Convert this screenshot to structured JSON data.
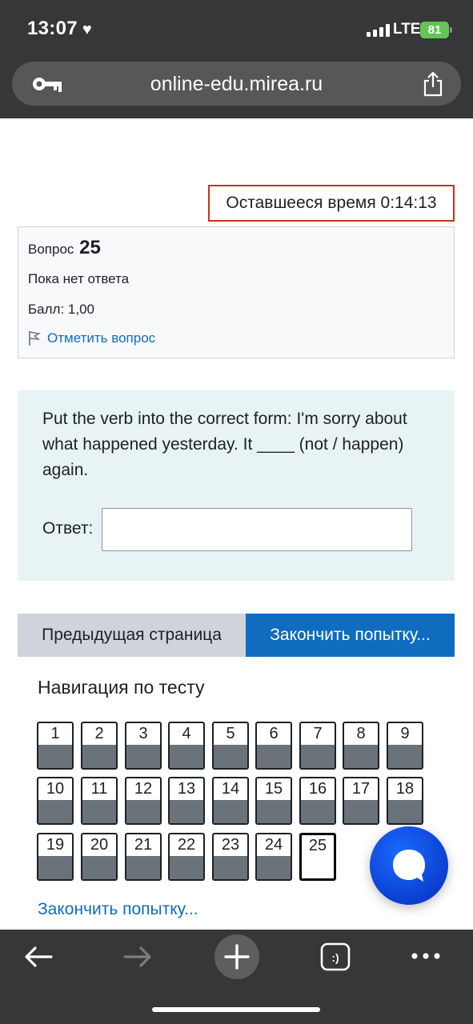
{
  "status_bar": {
    "time": "13:07",
    "network": "LTE",
    "battery": "81"
  },
  "browser": {
    "url": "online-edu.mirea.ru"
  },
  "page": {
    "timer_text": "Оставшееся время 0:14:13",
    "question_info": {
      "label": "Вопрос",
      "number": "25",
      "state": "Пока нет ответа",
      "grade": "Балл: 1,00",
      "flag_label": "Отметить вопрос"
    },
    "question": {
      "text": "Put the verb into the correct form: I'm sorry about what happened yesterday. It ____ (not / happen) again.",
      "answer_label": "Ответ:",
      "answer_value": ""
    },
    "buttons": {
      "previous": "Предыдущая страница",
      "finish": "Закончить попытку..."
    },
    "navigation": {
      "title": "Навигация по тесту",
      "questions": [
        "1",
        "2",
        "3",
        "4",
        "5",
        "6",
        "7",
        "8",
        "9",
        "10",
        "11",
        "12",
        "13",
        "14",
        "15",
        "16",
        "17",
        "18",
        "19",
        "20",
        "21",
        "22",
        "23",
        "24",
        "25"
      ],
      "current": "25",
      "finish_link": "Закончить попытку..."
    }
  },
  "colors": {
    "accent": "#0f6cbf",
    "timer_border": "#ca3120",
    "answered_fill": "#6b737a",
    "chrome": "#353739"
  }
}
